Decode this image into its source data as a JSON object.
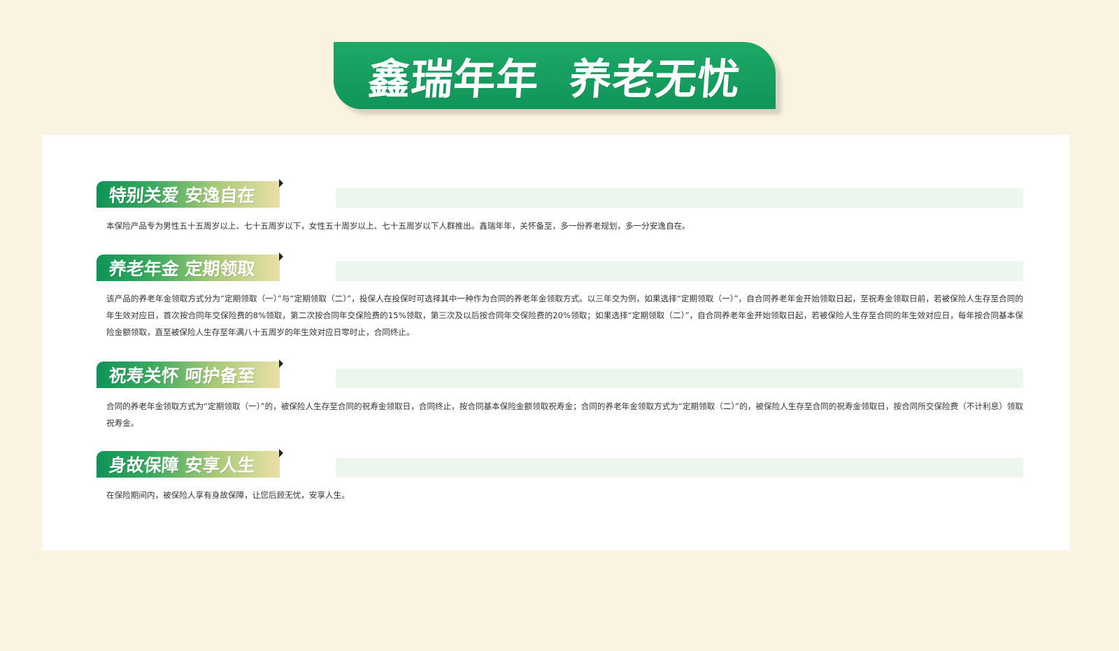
{
  "header": {
    "title": "鑫瑞年年  养老无忧"
  },
  "sections": [
    {
      "heading": "特别关爱  安逸自在",
      "body": "本保险产品专为男性五十五周岁以上、七十五周岁以下，女性五十周岁以上、七十五周岁以下人群推出。鑫瑞年年，关怀备至，多一份养老规划，多一分安逸自在。"
    },
    {
      "heading": "养老年金  定期领取",
      "body": "该产品的养老年金领取方式分为“定期领取（一）”与“定期领取（二）”，投保人在投保时可选择其中一种作为合同的养老年金领取方式。以三年交为例，如果选择“定期领取（一）”，自合同养老年金开始领取日起，至祝寿金领取日前，若被保险人生存至合同的年生效对应日，首次按合同年交保险费的8%领取，第二次按合同年交保险费的15%领取，第三次及以后按合同年交保险费的20%领取；如果选择“定期领取（二）”，自合同养老年金开始领取日起，若被保险人生存至合同的年生效对应日，每年按合同基本保险金额领取，直至被保险人生存至年满八十五周岁的年生效对应日零时止，合同终止。"
    },
    {
      "heading": "祝寿关怀  呵护备至",
      "body": "合同的养老年金领取方式为“定期领取（一）”的，被保险人生存至合同的祝寿金领取日，合同终止，按合同基本保险金额领取祝寿金；合同的养老年金领取方式为“定期领取（二）”的，被保险人生存至合同的祝寿金领取日，按合同所交保险费（不计利息）领取祝寿金。"
    },
    {
      "heading": "身故保障  安享人生",
      "body": "在保险期间内，被保险人享有身故保障，让您后顾无忧，安享人生。"
    }
  ]
}
